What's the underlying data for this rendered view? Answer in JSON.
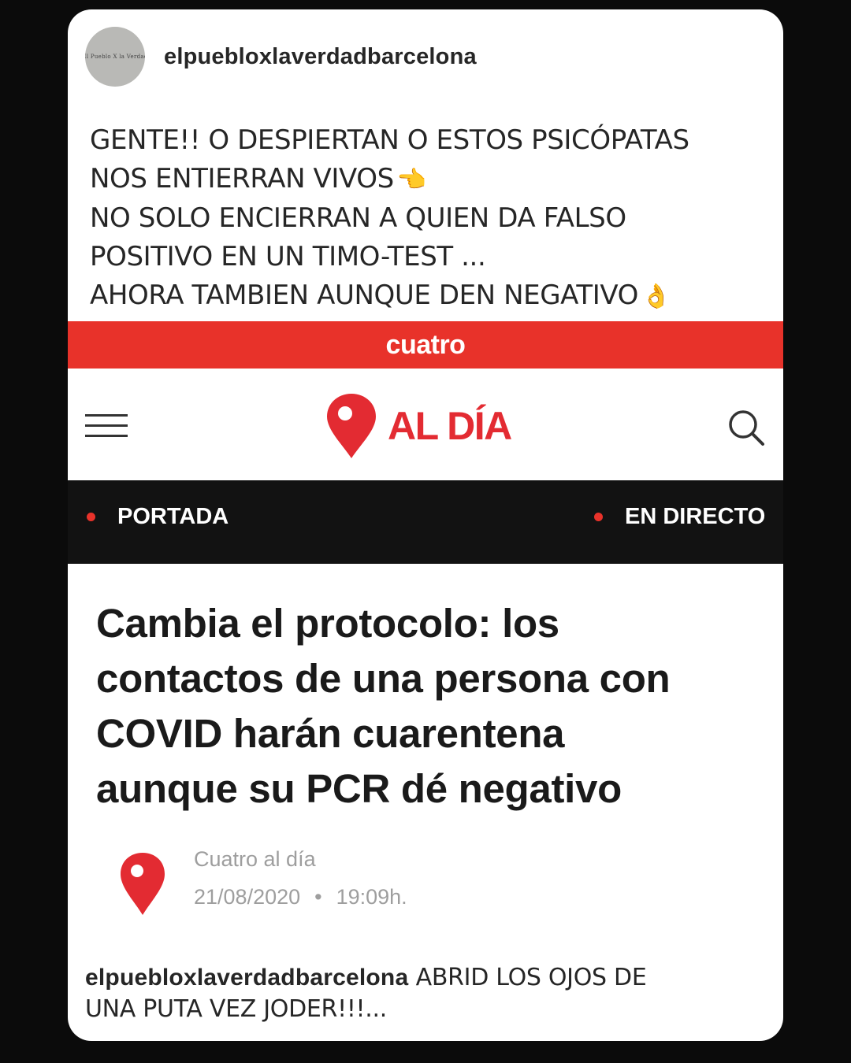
{
  "post": {
    "username": "elpuebloxlaverdadbarcelona",
    "avatar_text": "El Pueblo X la Verdad",
    "text_lines": [
      "GENTE!! O DESPIERTAN O ESTOS PSICÓPATAS",
      "NOS ENTIERRAN VIVOS",
      "NO SOLO ENCIERRAN A QUIEN DA FALSO",
      "POSITIVO EN UN TIMO-TEST ...",
      "AHORA TAMBIEN AUNQUE DEN NEGATIVO"
    ],
    "emoji_pointing": "👈",
    "emoji_ok": "👌"
  },
  "brand": {
    "name": "cuatro",
    "color": "#e8322a"
  },
  "site": {
    "logo_text": "AL DÍA",
    "logo_color": "#e32b32",
    "menu_icon": "hamburger-icon",
    "search_icon": "search-icon"
  },
  "nav": {
    "portada": "PORTADA",
    "directo": "EN DIRECTO"
  },
  "article": {
    "headline_lines": [
      "Cambia el protocolo: los",
      "contactos de una persona con",
      "COVID harán cuarentena",
      "aunque su PCR dé negativo"
    ],
    "source": "Cuatro al día",
    "date": "21/08/2020",
    "separator": "•",
    "time": "19:09h."
  },
  "caption": {
    "username": "elpuebloxlaverdadbarcelona",
    "text_line1": " ABRID LOS OJOS DE",
    "text_line2": "UNA PUTA VEZ JODER!!!..."
  }
}
